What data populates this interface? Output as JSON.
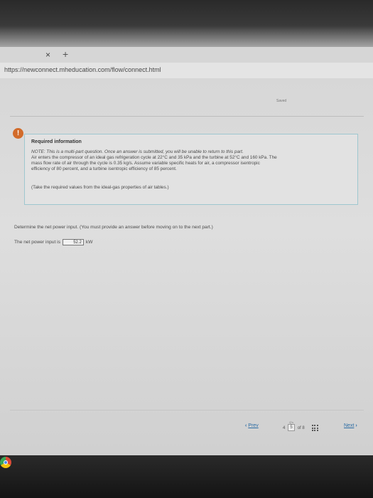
{
  "browser": {
    "tab_close": "×",
    "tab_new": "+",
    "url": "https://newconnect.mheducation.com/flow/connect.html"
  },
  "header": {
    "saved": "Saved"
  },
  "required_info": {
    "icon": "!",
    "title": "Required information",
    "note_lines": [
      "NOTE: This is a multi-part question. Once an answer is submitted, you will be unable to return to this part.",
      "Air enters the compressor of an ideal gas refrigeration cycle at 22°C and 35 kPa and the turbine at 52°C and 160 kPa. The",
      "mass flow rate of air through the cycle is 0.35 kg/s. Assume variable specific heats for air, a compressor isentropic",
      "efficiency of 80 percent, and a turbine isentropic efficiency of 85 percent."
    ],
    "take": "(Take the required values from the ideal-gas properties of air tables.)"
  },
  "question": {
    "determine": "Determine the net power input. (You must provide an answer before moving on to the next part.)",
    "net_label": "The net power input is",
    "answer_value": "52.2",
    "unit": "kW"
  },
  "footer": {
    "prev_label": "Prev",
    "prev_arrow": "‹",
    "pages_label": "Q's",
    "page_prev": "4",
    "page_current": "5",
    "page_of": "of 8",
    "next_label": "Next",
    "next_arrow": "›"
  },
  "colors": {
    "accent": "#2d6da4",
    "info_icon": "#d26b2a",
    "box_border": "#9ec7cf"
  }
}
